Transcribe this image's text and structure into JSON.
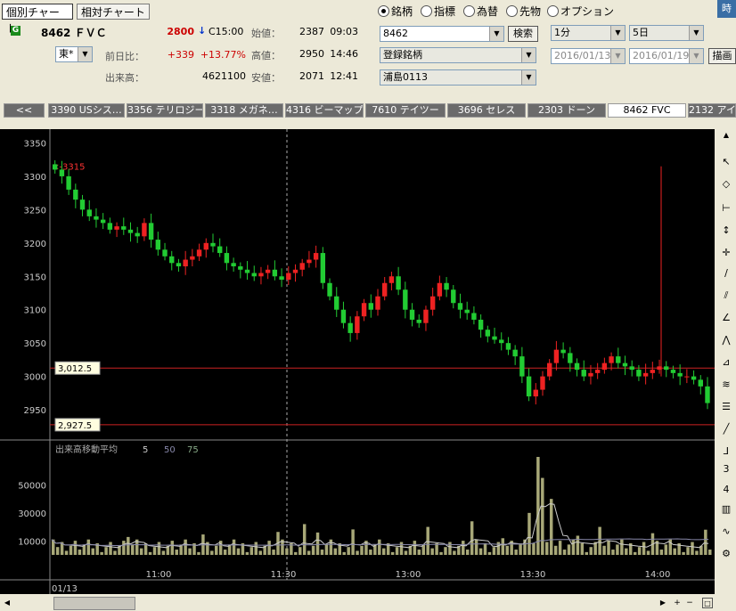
{
  "tabs": {
    "individual": "個別チャート",
    "relative": "相対チャート"
  },
  "stock": {
    "badge": "G",
    "code_name": "8462 ＦＶＣ",
    "price": "2800",
    "arrow": "↓",
    "time_label": "C15:00",
    "market": "東*"
  },
  "quote_labels": {
    "prev_diff": "前日比：",
    "volume": "出来高：",
    "open": "始値：",
    "high": "高値：",
    "low": "安値："
  },
  "quote": {
    "diff": "+339",
    "diff_pct": "+13.77%",
    "volume": "4621100",
    "open": "2387",
    "open_time": "09:03",
    "high": "2950",
    "high_time": "14:46",
    "low": "2071",
    "low_time": "12:41"
  },
  "radio": [
    {
      "label": "銘柄",
      "selected": true
    },
    {
      "label": "指標",
      "selected": false
    },
    {
      "label": "為替",
      "selected": false
    },
    {
      "label": "先物",
      "selected": false
    },
    {
      "label": "オプション",
      "selected": false
    }
  ],
  "search": {
    "value": "8462",
    "button": "検索"
  },
  "lists": {
    "registered": "登録銘柄",
    "group": "浦島0113"
  },
  "period": {
    "interval": "1分",
    "range": "5日",
    "from": "2016/01/13",
    "to": "2016/01/19",
    "draw_button": "描画"
  },
  "corner_button": "時",
  "stock_tabs": [
    {
      "label": "<<",
      "active": false
    },
    {
      "label": "3390 USシス…",
      "active": false
    },
    {
      "label": "3356 テリロジー",
      "active": false
    },
    {
      "label": "3318 メガネ…",
      "active": false
    },
    {
      "label": "4316 ビーマップ",
      "active": false
    },
    {
      "label": "7610 テイツー",
      "active": false
    },
    {
      "label": "3696 セレス",
      "active": false
    },
    {
      "label": "2303 ドーン",
      "active": false
    },
    {
      "label": "8462 FVC",
      "active": true
    },
    {
      "label": "2132 アイ",
      "active": false
    }
  ],
  "chart_data": {
    "type": "candlestick",
    "price_axis": {
      "ticks": [
        "3350",
        "3300",
        "3250",
        "3200",
        "3150",
        "3100",
        "3050",
        "3000",
        "2950"
      ],
      "ylim": [
        2910,
        3360
      ]
    },
    "volume_axis": {
      "ticks": [
        "50000",
        "30000",
        "10000"
      ],
      "ylim": [
        0,
        70000
      ]
    },
    "time_axis": {
      "ticks": [
        "11:00",
        "11:30",
        "13:00",
        "13:30",
        "14:00"
      ],
      "date_label": "01/13",
      "range": [
        "10:36",
        "14:27"
      ]
    },
    "high_marker": "<-3315",
    "level_lines": [
      {
        "label": "3,012.5",
        "value": 3012.5
      },
      {
        "label": "2,927.5",
        "value": 2927.5
      }
    ],
    "volume_legend": {
      "title": "出来高移動平均",
      "periods": [
        "5",
        "50",
        "75"
      ]
    },
    "candles_approx": [
      3310,
      3300,
      3280,
      3265,
      3250,
      3240,
      3235,
      3230,
      3220,
      3225,
      3220,
      3215,
      3210,
      3230,
      3205,
      3190,
      3180,
      3170,
      3165,
      3175,
      3180,
      3190,
      3200,
      3195,
      3185,
      3170,
      3165,
      3160,
      3155,
      3150,
      3155,
      3160,
      3150,
      3145,
      3155,
      3160,
      3170,
      3175,
      3185,
      3140,
      3120,
      3100,
      3080,
      3065,
      3090,
      3110,
      3100,
      3120,
      3140,
      3150,
      3130,
      3100,
      3085,
      3080,
      3100,
      3120,
      3140,
      3130,
      3110,
      3100,
      3095,
      3085,
      3070,
      3060,
      3055,
      3050,
      3040,
      3030,
      3000,
      2970,
      2980,
      3000,
      3020,
      3040,
      3035,
      3020,
      3010,
      3000,
      3005,
      3010,
      3020,
      3030,
      3020,
      3015,
      3010,
      3000,
      3005,
      3010,
      3015,
      3010,
      3005,
      3000,
      3000,
      2995,
      2985,
      2960
    ]
  }
}
